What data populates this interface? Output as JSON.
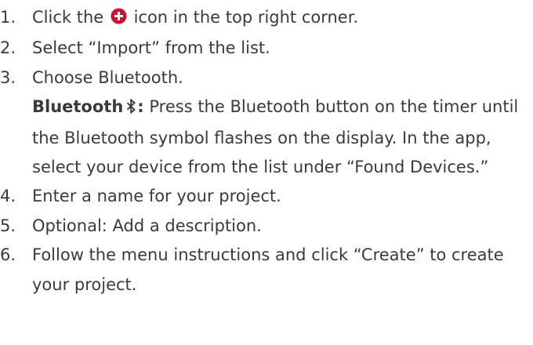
{
  "steps": [
    {
      "number": "1.",
      "before": "Click the",
      "icon": "plus-circle-icon",
      "icon_color": "#d0112b",
      "after": "icon in the top right corner."
    },
    {
      "number": "2.",
      "text": "Select “Import” from the list."
    },
    {
      "number": "3.",
      "text": "Choose Bluetooth.",
      "detail": {
        "title": "Bluetooth",
        "icon": "bluetooth-icon",
        "colon": ":",
        "text": "Press the Bluetooth button on the timer until the Bluetooth symbol flashes on the display. In the app, select your device from the list under “Found Devices.”"
      }
    },
    {
      "number": "4.",
      "text": "Enter a name for your project."
    },
    {
      "number": "5.",
      "text": "Optional: Add a description."
    },
    {
      "number": "6.",
      "text": "Follow the menu instructions and click “Create” to create your project."
    }
  ]
}
